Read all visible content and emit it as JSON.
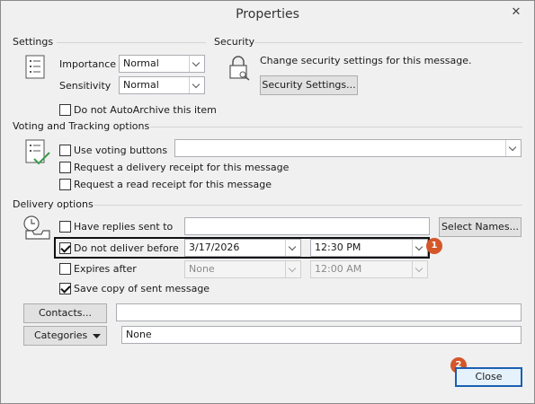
{
  "window": {
    "title": "Properties",
    "close_glyph": "✕"
  },
  "settings": {
    "header": "Settings",
    "importance_label": "Importance",
    "importance_value": "Normal",
    "sensitivity_label": "Sensitivity",
    "sensitivity_value": "Normal",
    "autoarchive_label": "Do not AutoArchive this item",
    "autoarchive_checked": false
  },
  "security": {
    "header": "Security",
    "description": "Change security settings for this message.",
    "button_label": "Security Settings..."
  },
  "voting": {
    "header": "Voting and Tracking options",
    "use_voting_label": "Use voting buttons",
    "use_voting_value": "",
    "delivery_receipt_label": "Request a delivery receipt for this message",
    "read_receipt_label": "Request a read receipt for this message"
  },
  "delivery": {
    "header": "Delivery options",
    "replies_label": "Have replies sent to",
    "replies_value": "",
    "select_names_label": "Select Names...",
    "do_not_deliver_label": "Do not deliver before",
    "do_not_deliver_checked": true,
    "deliver_date": "3/17/2026",
    "deliver_time": "12:30 PM",
    "expires_label": "Expires after",
    "expires_checked": false,
    "expires_date": "None",
    "expires_time": "12:00 AM",
    "save_copy_label": "Save copy of sent message",
    "save_copy_checked": true
  },
  "contacts": {
    "button_label": "Contacts...",
    "value": ""
  },
  "categories": {
    "button_label": "Categories",
    "value": "None"
  },
  "footer": {
    "close_label": "Close"
  },
  "callouts": {
    "badge_1": "1",
    "badge_2": "2"
  },
  "colors": {
    "badge": "#d4572a",
    "default_button_border": "#1b5fb3"
  }
}
